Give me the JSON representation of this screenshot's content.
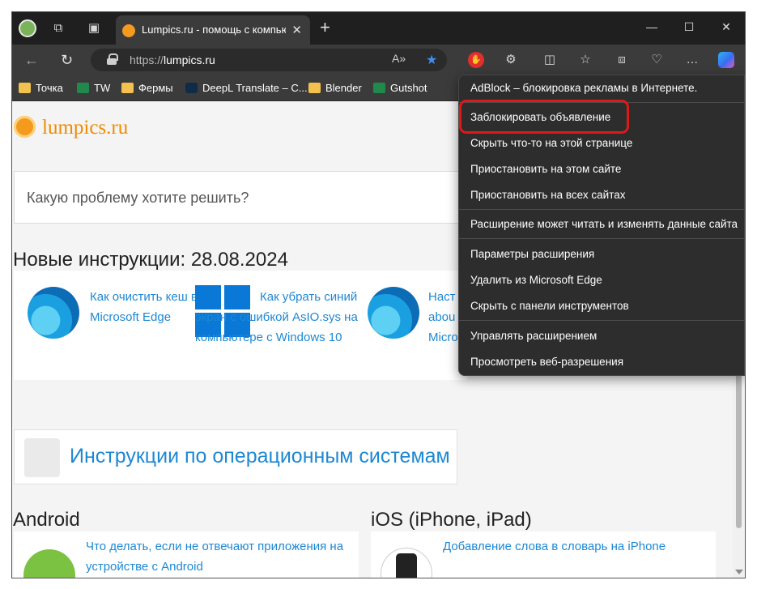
{
  "tab": {
    "title": "Lumpics.ru - помощь с компьюте"
  },
  "address": {
    "scheme": "https://",
    "host": "lumpics.ru"
  },
  "bookmarks": [
    {
      "label": "Точка",
      "icon": "folder-icon"
    },
    {
      "label": "TW",
      "icon": "tw-icon"
    },
    {
      "label": "Фермы",
      "icon": "folder-icon"
    },
    {
      "label": "DeepL Translate – C...",
      "icon": "deepl-icon"
    },
    {
      "label": "Blender",
      "icon": "folder-icon"
    },
    {
      "label": "Gutshot",
      "icon": "tw-icon"
    }
  ],
  "page": {
    "logo_text": "lumpics.ru",
    "search_placeholder": "Какую проблему хотите решить?",
    "new_title": "Новые инструкции: 28.08.2024",
    "articles": [
      {
        "title": "Как очистить кеш в Microsoft Edge"
      },
      {
        "title": "Как убрать синий экран с ошибкой AsIO.sys на компьютере с Windows 10"
      },
      {
        "title": "Наст abou Micro"
      }
    ],
    "os_title": "Инструкции по операционным системам",
    "android_title": "Android",
    "ios_title": "iOS (iPhone, iPad)",
    "android_article": "Что делать, если не отвечают приложения на устройстве с Android",
    "ios_article": "Добавление слова в словарь на iPhone"
  },
  "menu": {
    "header": "AdBlock – блокировка рекламы в Интернете.",
    "items": [
      "Заблокировать объявление",
      "Скрыть что-то на этой странице",
      "Приостановить на этом сайте",
      "Приостановить на всех сайтах",
      "Расширение может читать и изменять данные сайта",
      "Параметры расширения",
      "Удалить из Microsoft Edge",
      "Скрыть с панели инструментов",
      "Управлять расширением",
      "Просмотреть веб-разрешения"
    ]
  },
  "colors": {
    "accent": "#1e88d3",
    "highlight": "#e01818",
    "logo": "#f08a00"
  }
}
